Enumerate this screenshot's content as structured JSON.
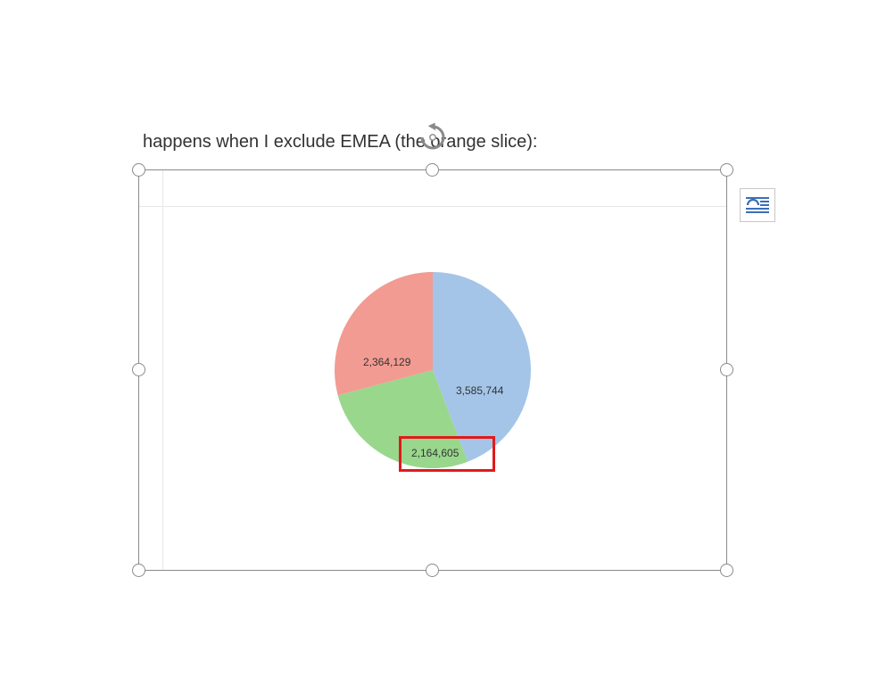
{
  "caption": "happens when I exclude EMEA (the orange slice):",
  "chart_data": {
    "type": "pie",
    "title": "",
    "slices": [
      {
        "name": "blue",
        "value": 3585744,
        "label": "3,585,744",
        "color": "#a4c5e8"
      },
      {
        "name": "green",
        "value": 2164605,
        "label": "2,164,605",
        "color": "#99d78d"
      },
      {
        "name": "red",
        "value": 2364129,
        "label": "2,364,129",
        "color": "#f29b92"
      }
    ],
    "highlighted_slice": "green"
  },
  "ui": {
    "layout_button_title": "Layout Options"
  }
}
